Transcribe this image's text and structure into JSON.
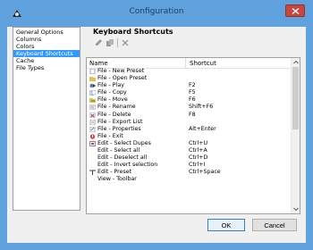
{
  "window": {
    "title": "Configuration",
    "accent": "#5fa2dd",
    "close_color": "#c9463d"
  },
  "nav": {
    "items": [
      {
        "label": "General Options",
        "selected": false
      },
      {
        "label": "Columns",
        "selected": false
      },
      {
        "label": "Colors",
        "selected": false
      },
      {
        "label": "Keyboard Shortcuts",
        "selected": true
      },
      {
        "label": "Cache",
        "selected": false
      },
      {
        "label": "File Types",
        "selected": false
      }
    ]
  },
  "panel": {
    "title": "Keyboard Shortcuts",
    "toolbar": {
      "icons": [
        "edit-icon",
        "copy-icon",
        "delete-icon"
      ]
    },
    "columns": {
      "name": "Name",
      "shortcut": "Shortcut"
    },
    "rows": [
      {
        "name": "File - New Preset",
        "shortcut": "",
        "icon": "new-file-icon"
      },
      {
        "name": "File - Open Preset",
        "shortcut": "",
        "icon": "open-folder-icon"
      },
      {
        "name": "File - Play",
        "shortcut": "F2",
        "icon": "play-icon"
      },
      {
        "name": "File - Copy",
        "shortcut": "F5",
        "icon": "copy-file-icon"
      },
      {
        "name": "File - Move",
        "shortcut": "F6",
        "icon": "move-icon"
      },
      {
        "name": "File - Rename",
        "shortcut": "Shift+F6",
        "icon": "rename-icon"
      },
      {
        "name": "File - Delete",
        "shortcut": "F8",
        "icon": "delete-file-icon"
      },
      {
        "name": "File - Export List",
        "shortcut": "",
        "icon": "export-list-icon"
      },
      {
        "name": "File - Properties",
        "shortcut": "Alt+Enter",
        "icon": "properties-icon"
      },
      {
        "name": "File - Exit",
        "shortcut": "",
        "icon": "exit-icon"
      },
      {
        "name": "Edit - Select Dupes",
        "shortcut": "Ctrl+U",
        "icon": "select-dupes-icon"
      },
      {
        "name": "Edit - Select all",
        "shortcut": "Ctrl+A",
        "icon": ""
      },
      {
        "name": "Edit - Deselect all",
        "shortcut": "Ctrl+D",
        "icon": ""
      },
      {
        "name": "Edit - Invert selection",
        "shortcut": "Ctrl+I",
        "icon": ""
      },
      {
        "name": "Edit - Preset",
        "shortcut": "Ctrl+Space",
        "icon": "edit-preset-icon"
      },
      {
        "name": "View - Toolbar",
        "shortcut": "",
        "icon": ""
      }
    ]
  },
  "buttons": {
    "ok": "OK",
    "cancel": "Cancel"
  }
}
